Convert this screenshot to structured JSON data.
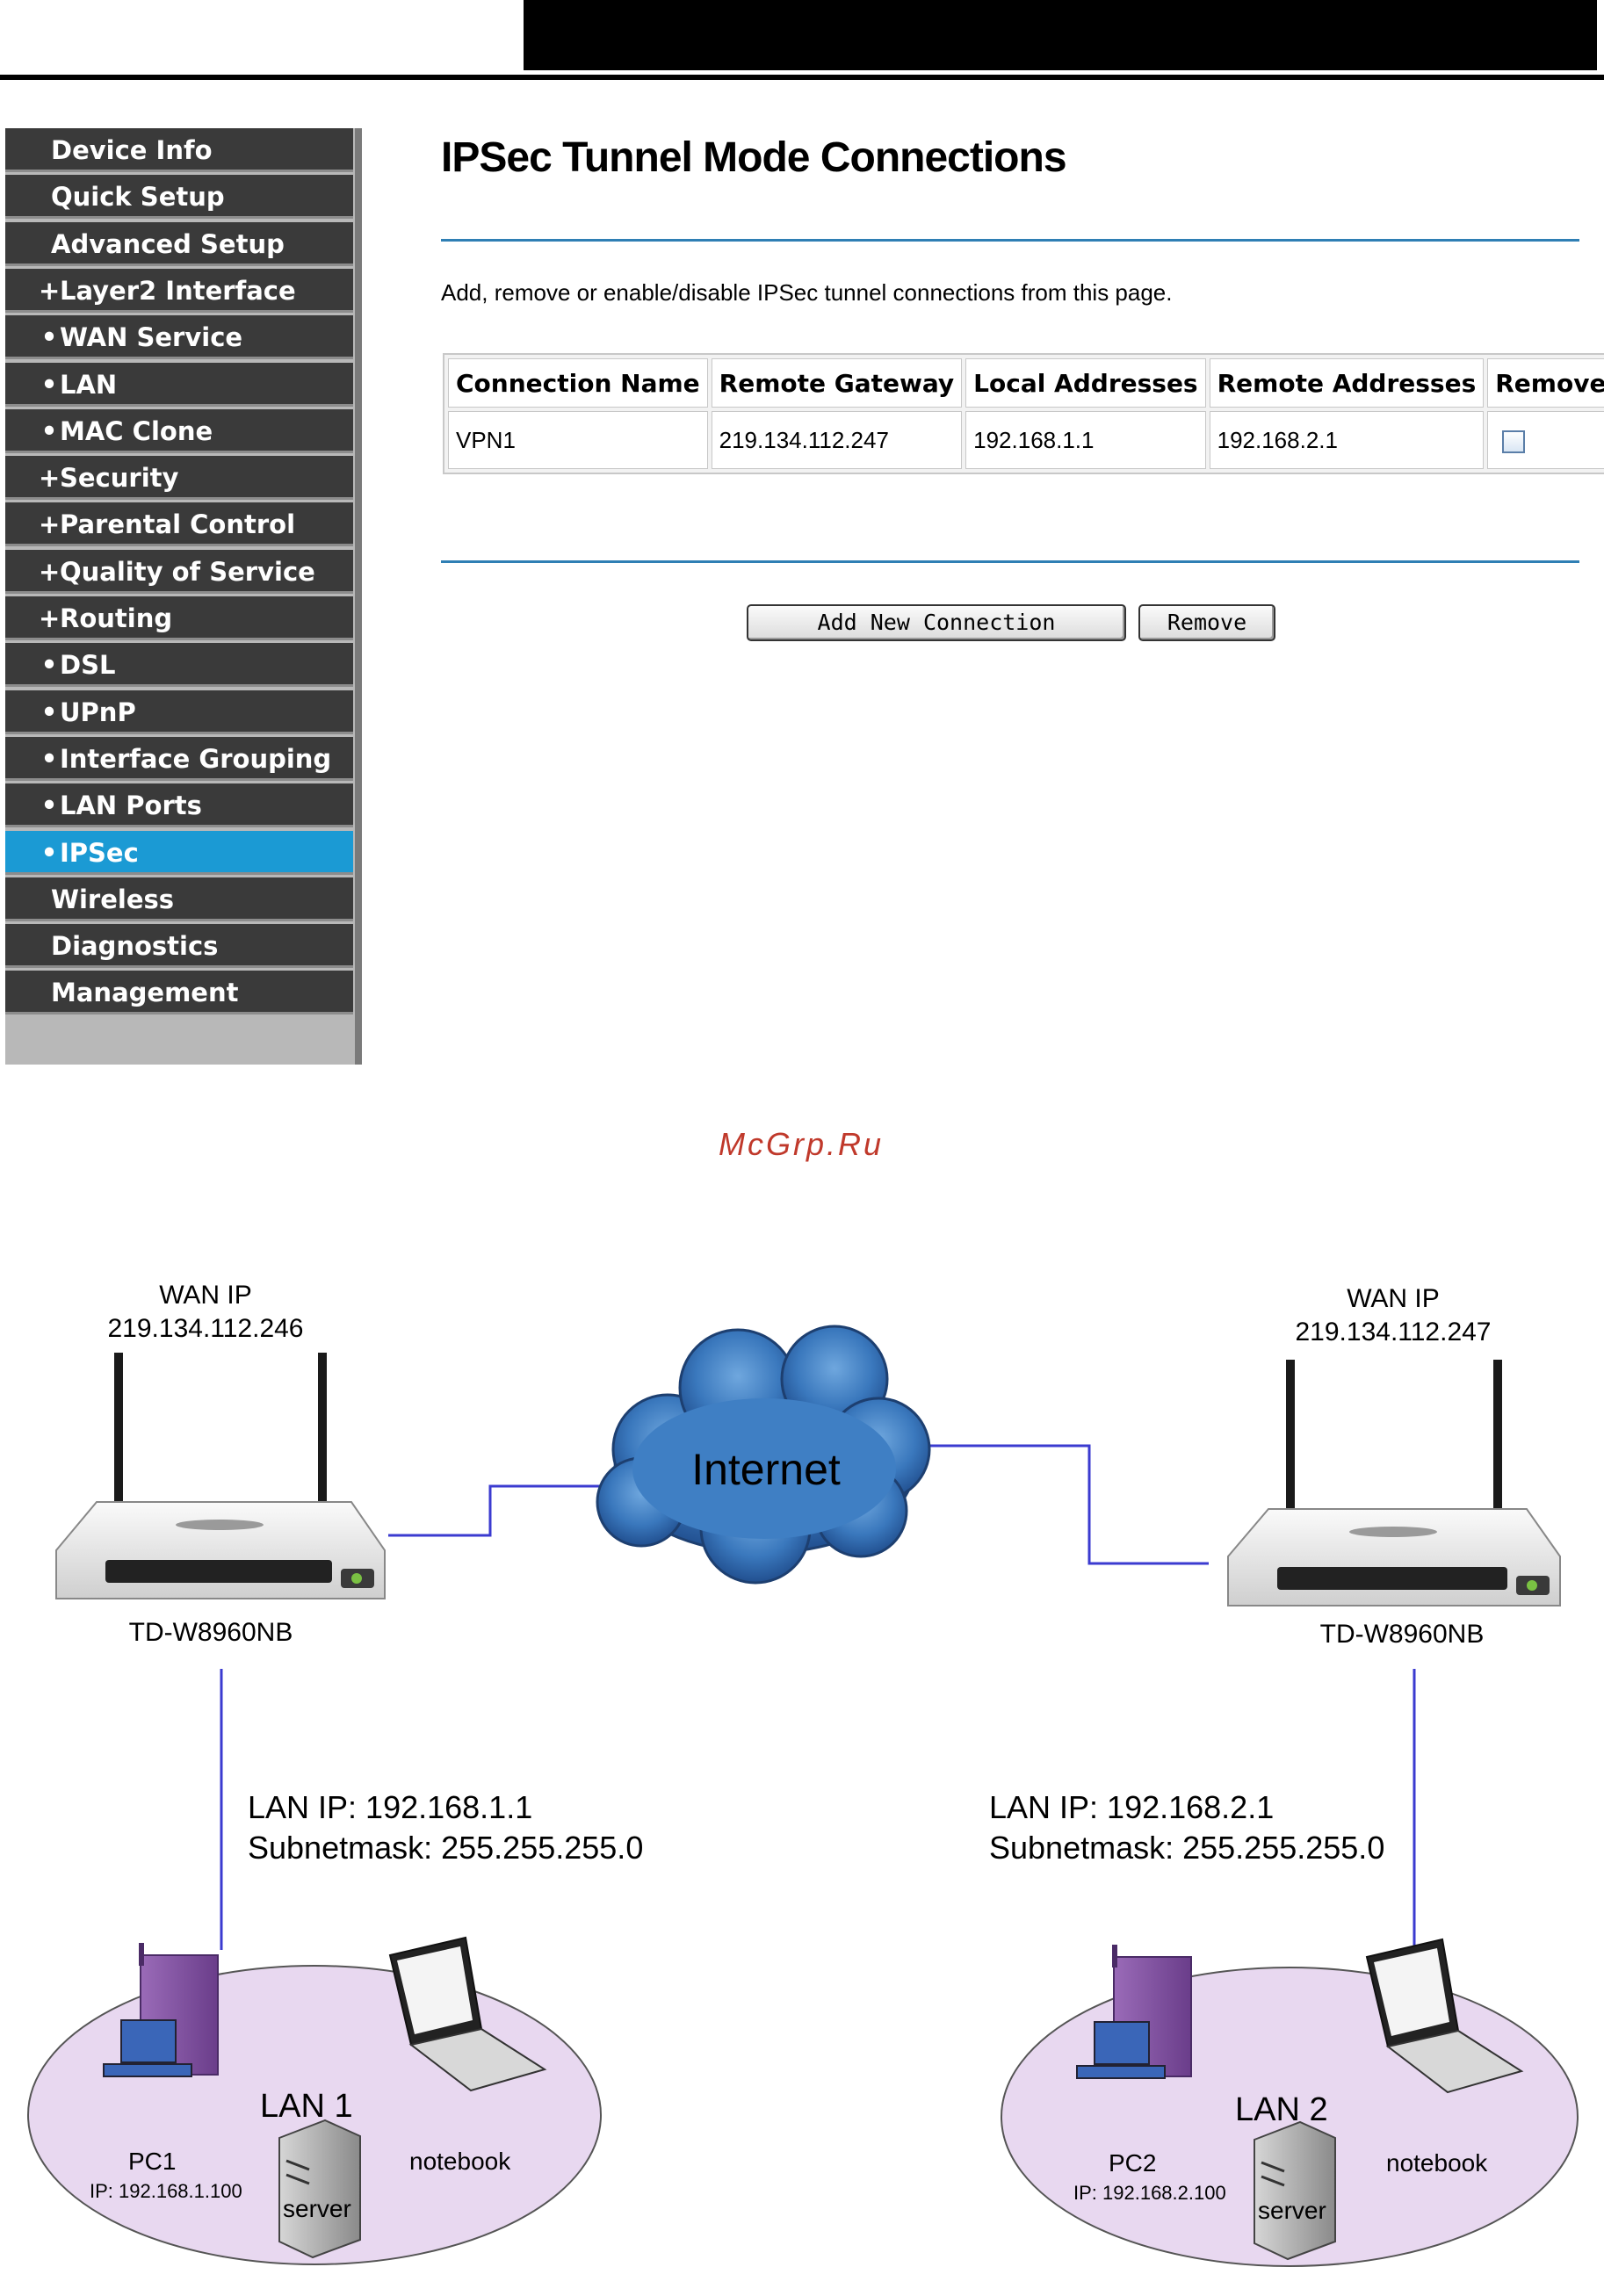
{
  "header": {},
  "sidebar": {
    "items": [
      {
        "label": "Device Info",
        "bullet": "",
        "sub": false
      },
      {
        "label": "Quick Setup",
        "bullet": "",
        "sub": false
      },
      {
        "label": "Advanced Setup",
        "bullet": "",
        "sub": false
      },
      {
        "label": "Layer2 Interface",
        "bullet": "+",
        "sub": true
      },
      {
        "label": "WAN Service",
        "bullet": "•",
        "sub": true
      },
      {
        "label": "LAN",
        "bullet": "•",
        "sub": true
      },
      {
        "label": "MAC Clone",
        "bullet": "•",
        "sub": true
      },
      {
        "label": "Security",
        "bullet": "+",
        "sub": true
      },
      {
        "label": "Parental Control",
        "bullet": "+",
        "sub": true
      },
      {
        "label": "Quality of Service",
        "bullet": "+",
        "sub": true
      },
      {
        "label": "Routing",
        "bullet": "+",
        "sub": true
      },
      {
        "label": "DSL",
        "bullet": "•",
        "sub": true
      },
      {
        "label": "UPnP",
        "bullet": "•",
        "sub": true
      },
      {
        "label": "Interface Grouping",
        "bullet": "•",
        "sub": true
      },
      {
        "label": "LAN Ports",
        "bullet": "•",
        "sub": true
      },
      {
        "label": "IPSec",
        "bullet": "•",
        "sub": true,
        "active": true
      },
      {
        "label": "Wireless",
        "bullet": "",
        "sub": false
      },
      {
        "label": "Diagnostics",
        "bullet": "",
        "sub": false
      },
      {
        "label": "Management",
        "bullet": "",
        "sub": false
      }
    ],
    "active_color": "#1b9ad4"
  },
  "main": {
    "title": "IPSec Tunnel Mode Connections",
    "description": "Add, remove or enable/disable IPSec tunnel connections from this page.",
    "table": {
      "headers": [
        "Connection Name",
        "Remote Gateway",
        "Local Addresses",
        "Remote Addresses",
        "Remove"
      ],
      "rows": [
        {
          "name": "VPN1",
          "gateway": "219.134.112.247",
          "local": "192.168.1.1",
          "remote": "192.168.2.1",
          "remove_checked": false
        }
      ]
    },
    "buttons": {
      "add": "Add New Connection",
      "remove": "Remove"
    }
  },
  "watermark": "McGrp.Ru",
  "diagram": {
    "cloud_label": "Internet",
    "left_router": {
      "wan_label": "WAN IP",
      "wan_ip": "219.134.112.246",
      "model": "TD-W8960NB",
      "lan_ip": "LAN IP: 192.168.1.1",
      "subnet": "Subnetmask: 255.255.255.0"
    },
    "right_router": {
      "wan_label": "WAN IP",
      "wan_ip": "219.134.112.247",
      "model": "TD-W8960NB",
      "lan_ip": "LAN IP: 192.168.2.1",
      "subnet": "Subnetmask: 255.255.255.0"
    },
    "lan1": {
      "name": "LAN 1",
      "pc": "PC1",
      "pc_ip": "IP: 192.168.1.100",
      "server": "server",
      "notebook": "notebook"
    },
    "lan2": {
      "name": "LAN 2",
      "pc": "PC2",
      "pc_ip": "IP: 192.168.2.100",
      "server": "server",
      "notebook": "notebook"
    },
    "link_color": "#3b3bd0",
    "lan_fill": "#e8d8f0"
  }
}
